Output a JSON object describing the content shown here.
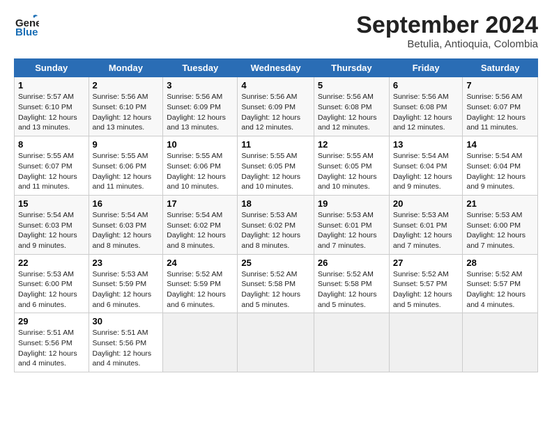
{
  "logo": {
    "line1": "General",
    "line2": "Blue"
  },
  "header": {
    "month": "September 2024",
    "location": "Betulia, Antioquia, Colombia"
  },
  "weekdays": [
    "Sunday",
    "Monday",
    "Tuesday",
    "Wednesday",
    "Thursday",
    "Friday",
    "Saturday"
  ],
  "weeks": [
    [
      {
        "day": "1",
        "info": "Sunrise: 5:57 AM\nSunset: 6:10 PM\nDaylight: 12 hours\nand 13 minutes."
      },
      {
        "day": "2",
        "info": "Sunrise: 5:56 AM\nSunset: 6:10 PM\nDaylight: 12 hours\nand 13 minutes."
      },
      {
        "day": "3",
        "info": "Sunrise: 5:56 AM\nSunset: 6:09 PM\nDaylight: 12 hours\nand 13 minutes."
      },
      {
        "day": "4",
        "info": "Sunrise: 5:56 AM\nSunset: 6:09 PM\nDaylight: 12 hours\nand 12 minutes."
      },
      {
        "day": "5",
        "info": "Sunrise: 5:56 AM\nSunset: 6:08 PM\nDaylight: 12 hours\nand 12 minutes."
      },
      {
        "day": "6",
        "info": "Sunrise: 5:56 AM\nSunset: 6:08 PM\nDaylight: 12 hours\nand 12 minutes."
      },
      {
        "day": "7",
        "info": "Sunrise: 5:56 AM\nSunset: 6:07 PM\nDaylight: 12 hours\nand 11 minutes."
      }
    ],
    [
      {
        "day": "8",
        "info": "Sunrise: 5:55 AM\nSunset: 6:07 PM\nDaylight: 12 hours\nand 11 minutes."
      },
      {
        "day": "9",
        "info": "Sunrise: 5:55 AM\nSunset: 6:06 PM\nDaylight: 12 hours\nand 11 minutes."
      },
      {
        "day": "10",
        "info": "Sunrise: 5:55 AM\nSunset: 6:06 PM\nDaylight: 12 hours\nand 10 minutes."
      },
      {
        "day": "11",
        "info": "Sunrise: 5:55 AM\nSunset: 6:05 PM\nDaylight: 12 hours\nand 10 minutes."
      },
      {
        "day": "12",
        "info": "Sunrise: 5:55 AM\nSunset: 6:05 PM\nDaylight: 12 hours\nand 10 minutes."
      },
      {
        "day": "13",
        "info": "Sunrise: 5:54 AM\nSunset: 6:04 PM\nDaylight: 12 hours\nand 9 minutes."
      },
      {
        "day": "14",
        "info": "Sunrise: 5:54 AM\nSunset: 6:04 PM\nDaylight: 12 hours\nand 9 minutes."
      }
    ],
    [
      {
        "day": "15",
        "info": "Sunrise: 5:54 AM\nSunset: 6:03 PM\nDaylight: 12 hours\nand 9 minutes."
      },
      {
        "day": "16",
        "info": "Sunrise: 5:54 AM\nSunset: 6:03 PM\nDaylight: 12 hours\nand 8 minutes."
      },
      {
        "day": "17",
        "info": "Sunrise: 5:54 AM\nSunset: 6:02 PM\nDaylight: 12 hours\nand 8 minutes."
      },
      {
        "day": "18",
        "info": "Sunrise: 5:53 AM\nSunset: 6:02 PM\nDaylight: 12 hours\nand 8 minutes."
      },
      {
        "day": "19",
        "info": "Sunrise: 5:53 AM\nSunset: 6:01 PM\nDaylight: 12 hours\nand 7 minutes."
      },
      {
        "day": "20",
        "info": "Sunrise: 5:53 AM\nSunset: 6:01 PM\nDaylight: 12 hours\nand 7 minutes."
      },
      {
        "day": "21",
        "info": "Sunrise: 5:53 AM\nSunset: 6:00 PM\nDaylight: 12 hours\nand 7 minutes."
      }
    ],
    [
      {
        "day": "22",
        "info": "Sunrise: 5:53 AM\nSunset: 6:00 PM\nDaylight: 12 hours\nand 6 minutes."
      },
      {
        "day": "23",
        "info": "Sunrise: 5:53 AM\nSunset: 5:59 PM\nDaylight: 12 hours\nand 6 minutes."
      },
      {
        "day": "24",
        "info": "Sunrise: 5:52 AM\nSunset: 5:59 PM\nDaylight: 12 hours\nand 6 minutes."
      },
      {
        "day": "25",
        "info": "Sunrise: 5:52 AM\nSunset: 5:58 PM\nDaylight: 12 hours\nand 5 minutes."
      },
      {
        "day": "26",
        "info": "Sunrise: 5:52 AM\nSunset: 5:58 PM\nDaylight: 12 hours\nand 5 minutes."
      },
      {
        "day": "27",
        "info": "Sunrise: 5:52 AM\nSunset: 5:57 PM\nDaylight: 12 hours\nand 5 minutes."
      },
      {
        "day": "28",
        "info": "Sunrise: 5:52 AM\nSunset: 5:57 PM\nDaylight: 12 hours\nand 4 minutes."
      }
    ],
    [
      {
        "day": "29",
        "info": "Sunrise: 5:51 AM\nSunset: 5:56 PM\nDaylight: 12 hours\nand 4 minutes."
      },
      {
        "day": "30",
        "info": "Sunrise: 5:51 AM\nSunset: 5:56 PM\nDaylight: 12 hours\nand 4 minutes."
      },
      {
        "day": "",
        "info": ""
      },
      {
        "day": "",
        "info": ""
      },
      {
        "day": "",
        "info": ""
      },
      {
        "day": "",
        "info": ""
      },
      {
        "day": "",
        "info": ""
      }
    ]
  ]
}
